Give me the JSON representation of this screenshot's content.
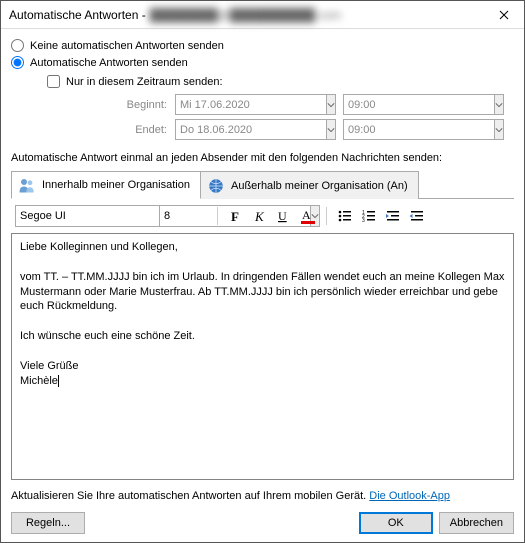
{
  "window": {
    "title_prefix": "Automatische Antworten - ",
    "title_email_obscured": "████████@██████████.com"
  },
  "radios": {
    "no_send": "Keine automatischen Antworten senden",
    "send": "Automatische Antworten senden"
  },
  "timerange": {
    "checkbox_label": "Nur in diesem Zeitraum senden:",
    "begin_label": "Beginnt:",
    "end_label": "Endet:",
    "begin_date": "Mi 17.06.2020",
    "begin_time": "09:00",
    "end_date": "Do 18.06.2020",
    "end_time": "09:00"
  },
  "section_label": "Automatische Antwort einmal an jeden Absender mit den folgenden Nachrichten senden:",
  "tabs": {
    "inside": "Innerhalb meiner Organisation",
    "outside": "Außerhalb meiner Organisation (An)"
  },
  "toolbar": {
    "font_name": "Segoe UI",
    "font_size": "8"
  },
  "editor": {
    "body": "Liebe Kolleginnen und Kollegen,\n\nvom TT. – TT.MM.JJJJ bin ich im Urlaub. In dringenden Fällen wendet euch an meine Kollegen Max Mustermann oder Marie Musterfrau. Ab TT.MM.JJJJ bin ich persönlich wieder erreichbar und gebe euch Rückmeldung.\n\nIch wünsche euch eine schöne Zeit.\n\nViele Grüße\nMichèle"
  },
  "footer": {
    "note": "Aktualisieren Sie Ihre automatischen Antworten auf Ihrem mobilen Gerät. ",
    "link": "Die Outlook-App"
  },
  "buttons": {
    "rules": "Regeln...",
    "ok": "OK",
    "cancel": "Abbrechen"
  }
}
